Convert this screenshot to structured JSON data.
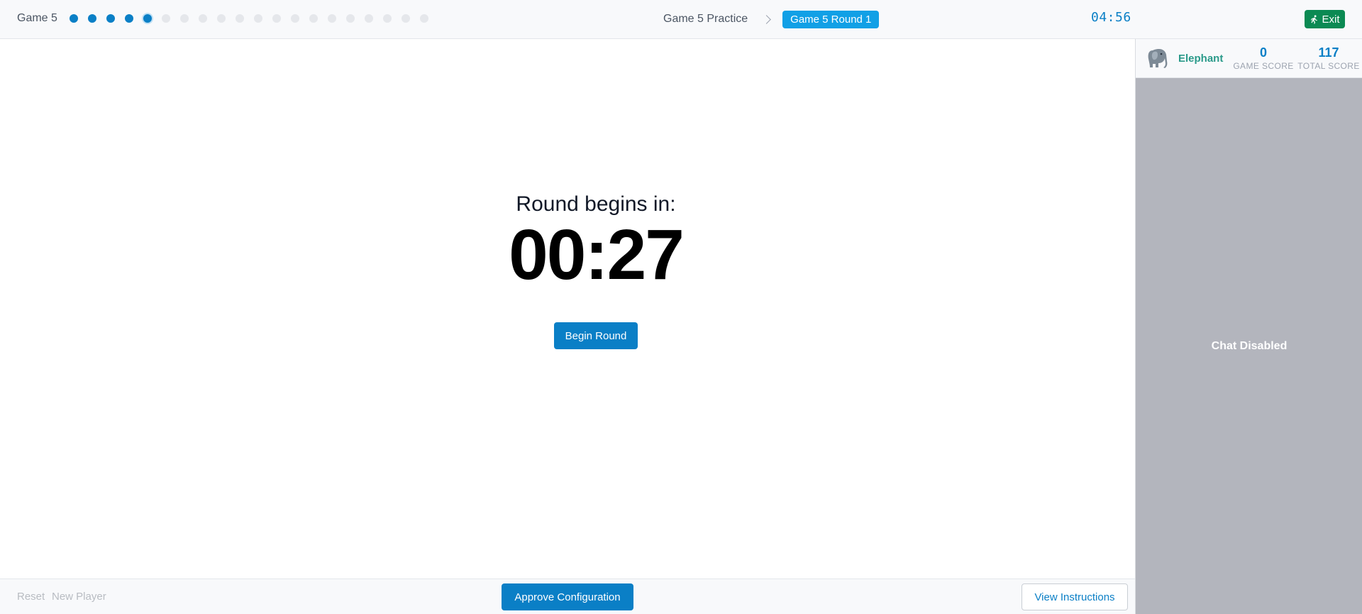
{
  "header": {
    "game_label": "Game 5",
    "progress": {
      "total": 20,
      "completed": 4,
      "current_index": 4
    },
    "breadcrumb": {
      "previous": "Game 5 Practice",
      "current": "Game 5 Round 1"
    },
    "timer": "04:56",
    "exit_label": "Exit",
    "colors": {
      "accent": "#0a7fc6",
      "exit": "#0b8a53",
      "active_crumb": "#11a0e6"
    }
  },
  "player": {
    "name": "Elephant",
    "avatar_icon": "elephant-icon",
    "game_score": "0",
    "game_score_label": "GAME SCORE",
    "total_score": "117",
    "total_score_label": "TOTAL SCORE"
  },
  "chat": {
    "status": "Chat Disabled"
  },
  "main": {
    "countdown_label": "Round begins in:",
    "countdown_value": "00:27",
    "begin_label": "Begin Round"
  },
  "footer": {
    "reset_label": "Reset",
    "new_player_label": "New Player",
    "approve_label": "Approve Configuration",
    "instructions_label": "View Instructions"
  }
}
